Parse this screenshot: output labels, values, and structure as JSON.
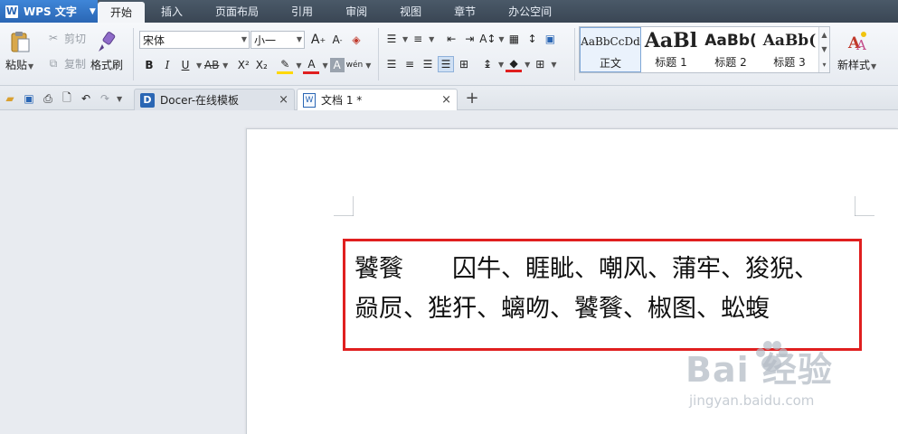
{
  "app": {
    "button_label": "WPS 文字",
    "logo_letter": "W"
  },
  "menu": {
    "tabs": [
      "开始",
      "插入",
      "页面布局",
      "引用",
      "审阅",
      "视图",
      "章节",
      "办公空间"
    ]
  },
  "ribbon": {
    "clipboard": {
      "paste_label": "粘贴",
      "cut_label": "剪切",
      "copy_label": "复制",
      "format_painter_label": "格式刷"
    },
    "font": {
      "font_name": "宋体",
      "font_size": "小一",
      "bold": "B",
      "italic": "I",
      "underline": "U",
      "strike": "AB",
      "superscript": "X²",
      "subscript": "X₂",
      "font_color_letter": "A",
      "char_shading_letter": "A",
      "phonetic_label": "wén"
    },
    "styles": {
      "items": [
        {
          "sample": "AaBbCcDd",
          "caption": "正文"
        },
        {
          "sample": "AaBl",
          "caption": "标题 1"
        },
        {
          "sample": "AaBb(",
          "caption": "标题 2"
        },
        {
          "sample": "AaBb(",
          "caption": "标题 3"
        }
      ],
      "new_style_label": "新样式"
    }
  },
  "tabs": {
    "docer_label": "Docer-在线模板",
    "doc_label": "文档 1 *",
    "close_glyph": "×",
    "new_tab_glyph": "+"
  },
  "document": {
    "line1": "饕餮　　囚牛、睚眦、嘲风、蒲牢、狻猊、",
    "line2": "赑屃、狴犴、螭吻、饕餮、椒图、蚣蝮"
  },
  "watermark": {
    "main": "Bai  经验",
    "sub": "jingyan.baidu.com"
  },
  "colors": {
    "highlight": "#ffd800",
    "font_color": "#e01f1f",
    "box_border": "#e01f1f"
  }
}
